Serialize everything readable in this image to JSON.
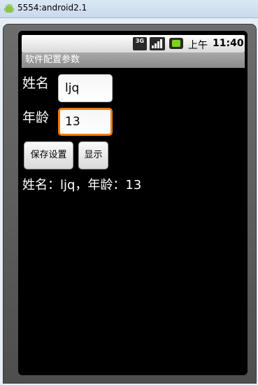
{
  "window": {
    "title": "5554:android2.1"
  },
  "status_bar": {
    "network_badge": "3G",
    "time_period": "上午",
    "time": "11:40",
    "icons": [
      "3g-icon",
      "signal-icon",
      "battery-icon"
    ]
  },
  "app": {
    "title": "软件配置参数"
  },
  "form": {
    "name_label": "姓名",
    "name_value": "ljq",
    "age_label": "年龄",
    "age_value": "13"
  },
  "buttons": {
    "save_label": "保存设置",
    "show_label": "显示"
  },
  "result": {
    "text": "姓名：ljq，年龄：13"
  },
  "colors": {
    "focus_border": "#f17c0e",
    "screen_bg": "#000000",
    "title_bar": "#8a8a8a"
  }
}
